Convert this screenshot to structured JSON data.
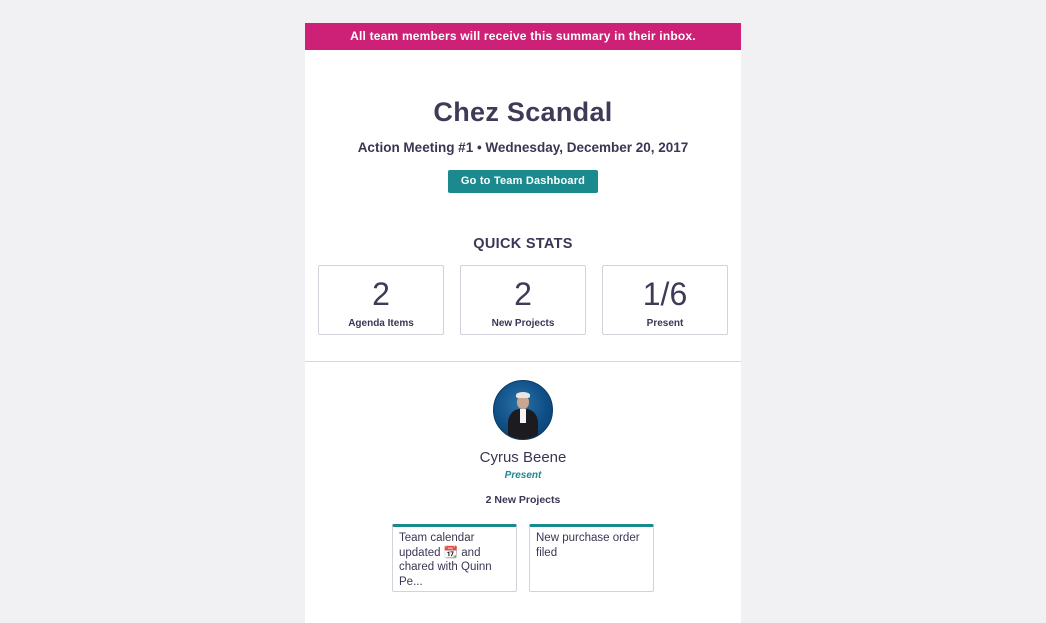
{
  "banner": {
    "text": "All team members will receive this summary in their inbox."
  },
  "header": {
    "team_name": "Chez Scandal",
    "meeting_info": "Action Meeting #1 • Wednesday, December 20, 2017",
    "dashboard_button": "Go to Team Dashboard"
  },
  "quick_stats": {
    "title": "QUICK STATS",
    "items": [
      {
        "value": "2",
        "label": "Agenda Items"
      },
      {
        "value": "2",
        "label": "New Projects"
      },
      {
        "value": "1/6",
        "label": "Present"
      }
    ]
  },
  "member": {
    "name": "Cyrus Beene",
    "status": "Present",
    "projects_summary": "2 New Projects",
    "projects": [
      {
        "text": "Team calendar updated 📆 and chared with Quinn Pe..."
      },
      {
        "text": "New purchase order filed"
      }
    ]
  },
  "colors": {
    "banner": "#cc2176",
    "accent": "#1b8a8e",
    "text": "#3b3654",
    "background": "#f1f0f3"
  }
}
